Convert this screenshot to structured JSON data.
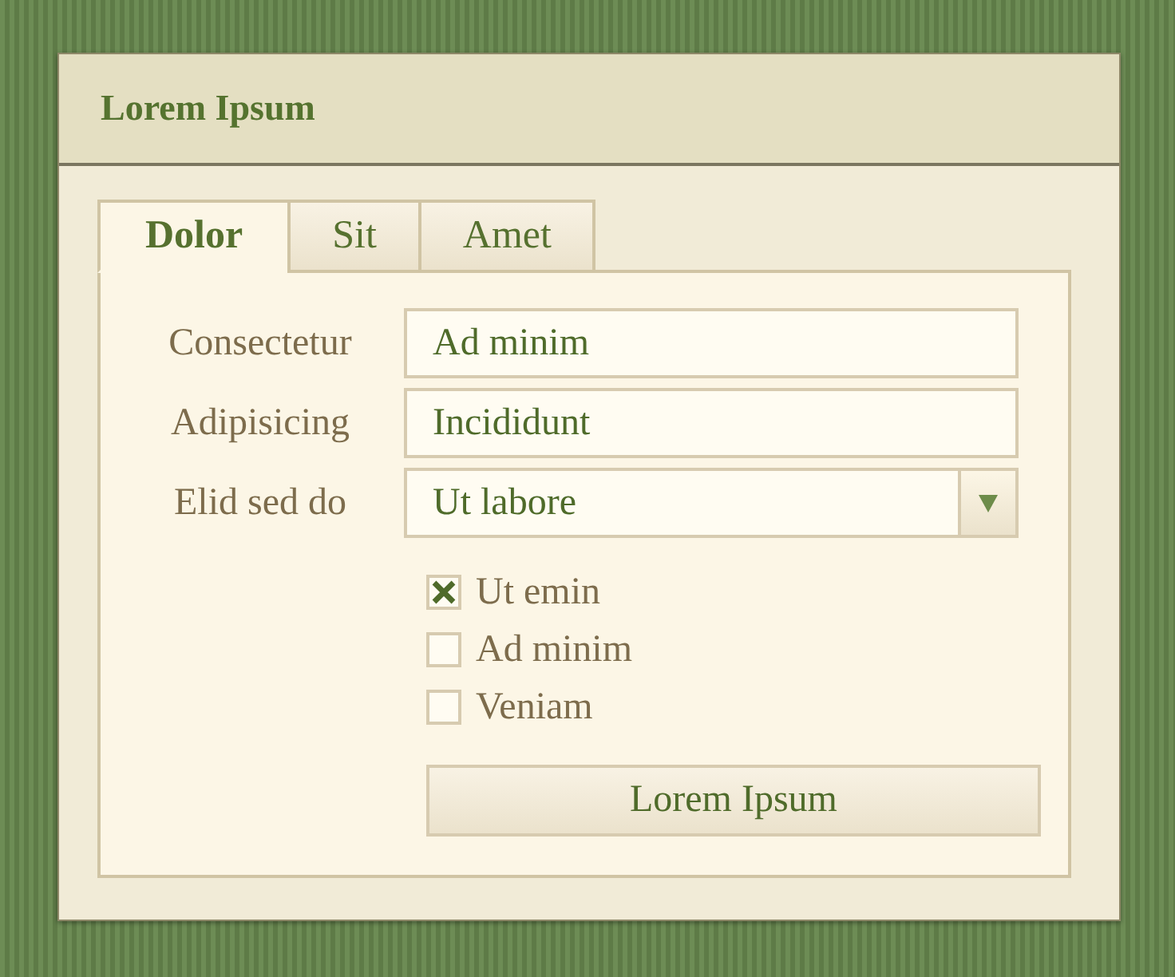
{
  "panel": {
    "title": "Lorem Ipsum"
  },
  "tabs": [
    {
      "label": "Dolor",
      "selected": true
    },
    {
      "label": "Sit",
      "selected": false
    },
    {
      "label": "Amet",
      "selected": false
    }
  ],
  "form": {
    "fields": [
      {
        "kind": "text",
        "label": "Consectetur",
        "value": "Ad minim"
      },
      {
        "kind": "text",
        "label": "Adipisicing",
        "value": "Incididunt"
      },
      {
        "kind": "select",
        "label": "Elid sed do",
        "value": "Ut labore"
      }
    ],
    "checkboxes": [
      {
        "label": "Ut emin",
        "checked": true
      },
      {
        "label": "Ad minim",
        "checked": false
      },
      {
        "label": "Veniam",
        "checked": false
      }
    ],
    "button": "Lorem Ipsum"
  }
}
